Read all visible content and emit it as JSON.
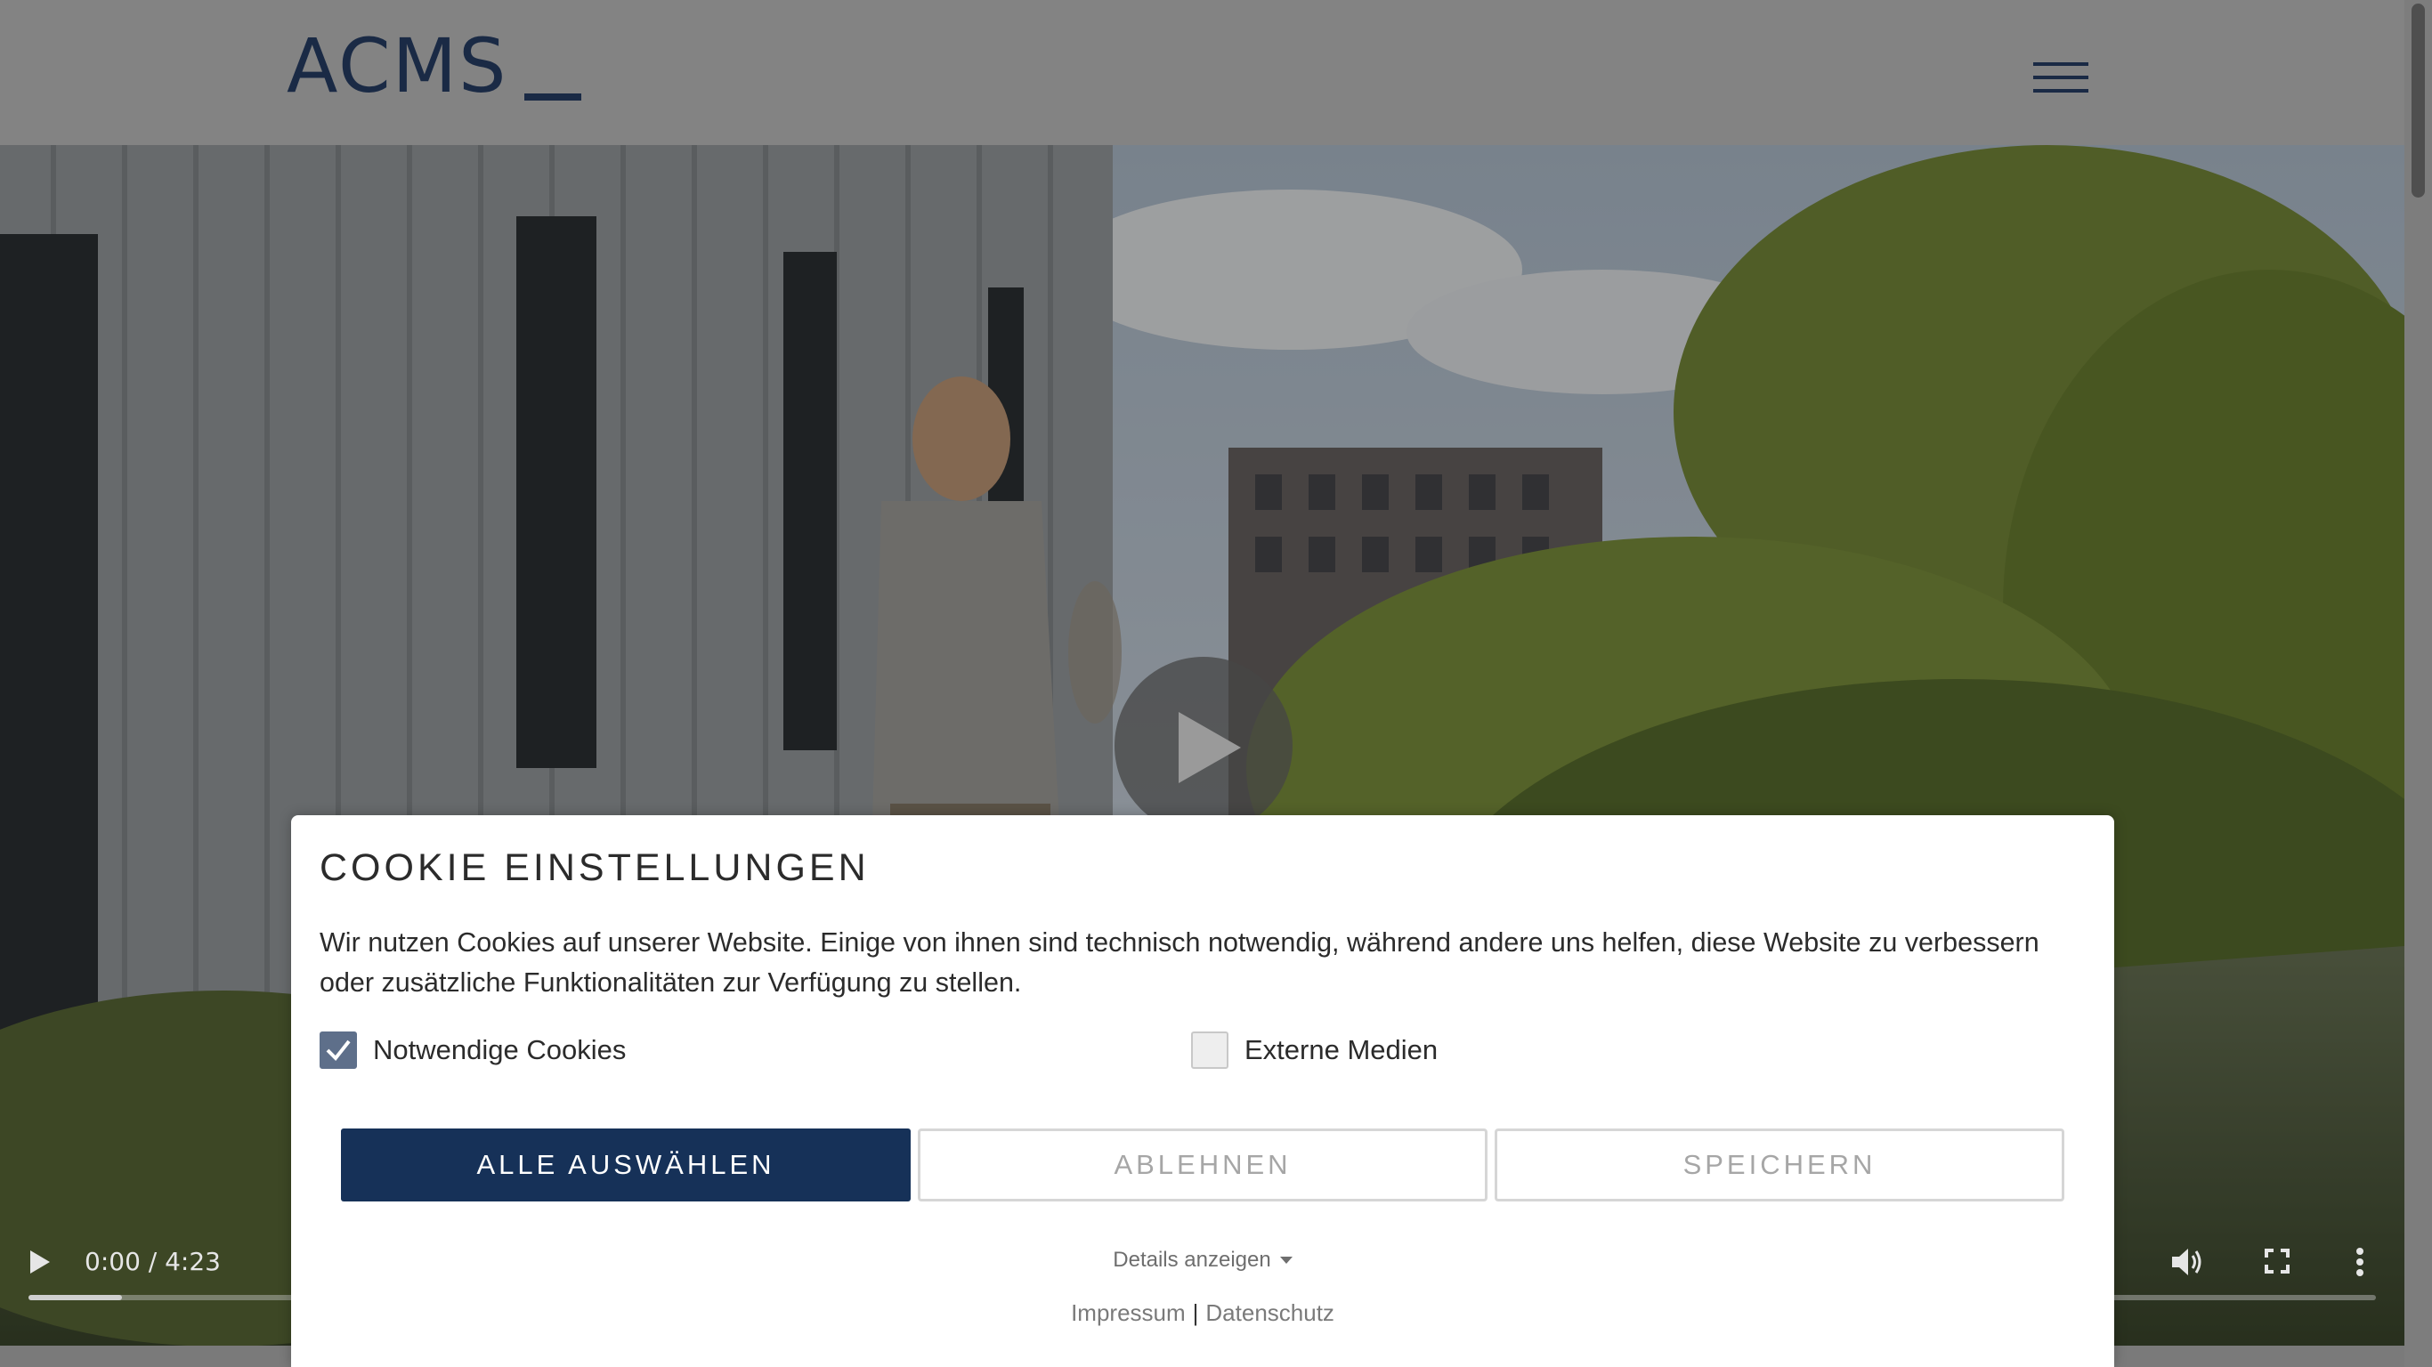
{
  "header": {
    "logo_text": "ACMS",
    "menu_icon": "hamburger-menu-icon"
  },
  "video": {
    "play_icon": "play-circle-icon",
    "current_time": "0:00 / 4:23",
    "progress_fraction": 0.04,
    "controls": {
      "play_icon": "play-icon",
      "volume_icon": "volume-icon",
      "fullscreen_icon": "fullscreen-icon",
      "more_icon": "more-vertical-icon"
    }
  },
  "cookie": {
    "title": "COOKIE EINSTELLUNGEN",
    "text": "Wir nutzen Cookies auf unserer Website. Einige von ihnen sind technisch notwendig, während andere uns helfen, diese Website zu verbessern oder zusätzliche Funktionalitäten zur Verfügung zu stellen.",
    "options": [
      {
        "label": "Notwendige Cookies",
        "checked": true
      },
      {
        "label": "Externe Medien",
        "checked": false
      }
    ],
    "buttons": {
      "select_all": "ALLE AUSWÄHLEN",
      "decline": "ABLEHNEN",
      "save": "SPEICHERN"
    },
    "details_label": "Details anzeigen",
    "links": {
      "imprint": "Impressum",
      "separator": "|",
      "privacy": "Datenschutz"
    }
  },
  "colors": {
    "brand_navy": "#163158",
    "logo": "#1a2a45",
    "checkbox_checked": "#5e6f8a"
  }
}
